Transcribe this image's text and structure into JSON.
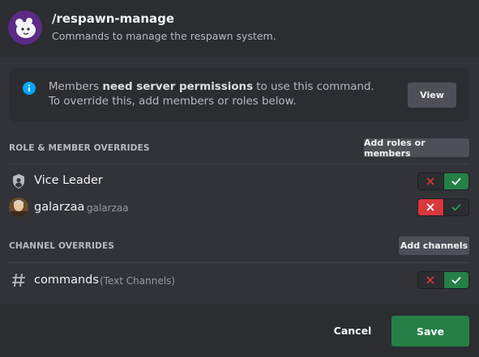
{
  "command": {
    "name": "/respawn-manage",
    "description": "Commands to manage the respawn system."
  },
  "notice": {
    "prefix": "Members ",
    "emphasis": "need server permissions",
    "suffix": " to use this command. To override this, add members or roles below.",
    "view_label": "View"
  },
  "role_section": {
    "title": "ROLE & MEMBER OVERRIDES",
    "add_label": "Add roles or members",
    "rows": [
      {
        "name": "Vice Leader",
        "sub": "",
        "icon": "shield-role-icon",
        "state": "allow"
      },
      {
        "name": "galarzaa",
        "sub": "galarzaa",
        "icon": "avatar",
        "state": "deny"
      }
    ]
  },
  "channel_section": {
    "title": "CHANNEL OVERRIDES",
    "add_label": "Add channels",
    "rows": [
      {
        "name": "commands",
        "sub": "(Text Channels)",
        "icon": "hash-icon",
        "state": "allow"
      }
    ]
  },
  "footer": {
    "cancel_label": "Cancel",
    "save_label": "Save"
  },
  "colors": {
    "allow": "#248046",
    "deny": "#da373c",
    "info": "#00a8fc",
    "background": "#313338"
  }
}
